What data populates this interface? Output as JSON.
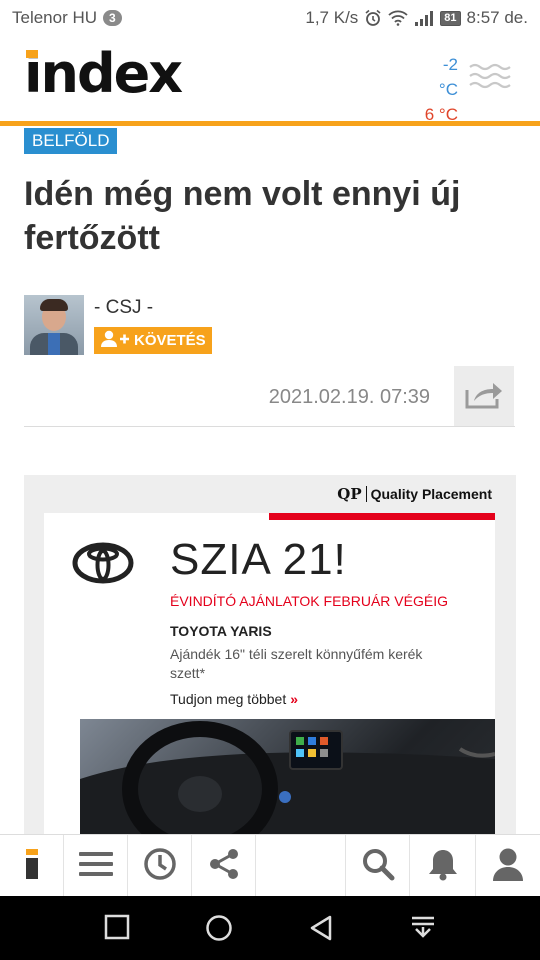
{
  "status_bar": {
    "carrier": "Telenor HU",
    "notification_count": "3",
    "speed": "1,7 K/s",
    "battery": "81",
    "time": "8:57 de."
  },
  "header": {
    "logo": "index",
    "temp_low": "-2 °C",
    "temp_high": "6 °C",
    "colors": {
      "accent": "#f7a21b",
      "temp_low": "#3d8fd6",
      "temp_high": "#e0452a"
    }
  },
  "article": {
    "category": "BELFÖLD",
    "headline": "Idén még nem volt ennyi új fertőzött",
    "author": "- CSJ -",
    "follow_label": "KÖVETÉS",
    "date": "2021.02.19. 07:39"
  },
  "ad": {
    "qp_mark": "QP",
    "qp_label": "Quality Placement",
    "title": "SZIA 21!",
    "subtitle": "ÉVINDÍTÓ AJÁNLATOK FEBRUÁR VÉGÉIG",
    "model": "TOYOTA YARIS",
    "description": "Ajándék 16\" téli szerelt könnyűfém kerék szett*",
    "link": "Tudjon meg többet",
    "link_arrow": "»"
  },
  "bottom_nav": {
    "items": [
      "index-home-icon",
      "menu-icon",
      "clock-icon",
      "share-icon",
      "search-icon",
      "bell-icon",
      "user-icon"
    ]
  }
}
